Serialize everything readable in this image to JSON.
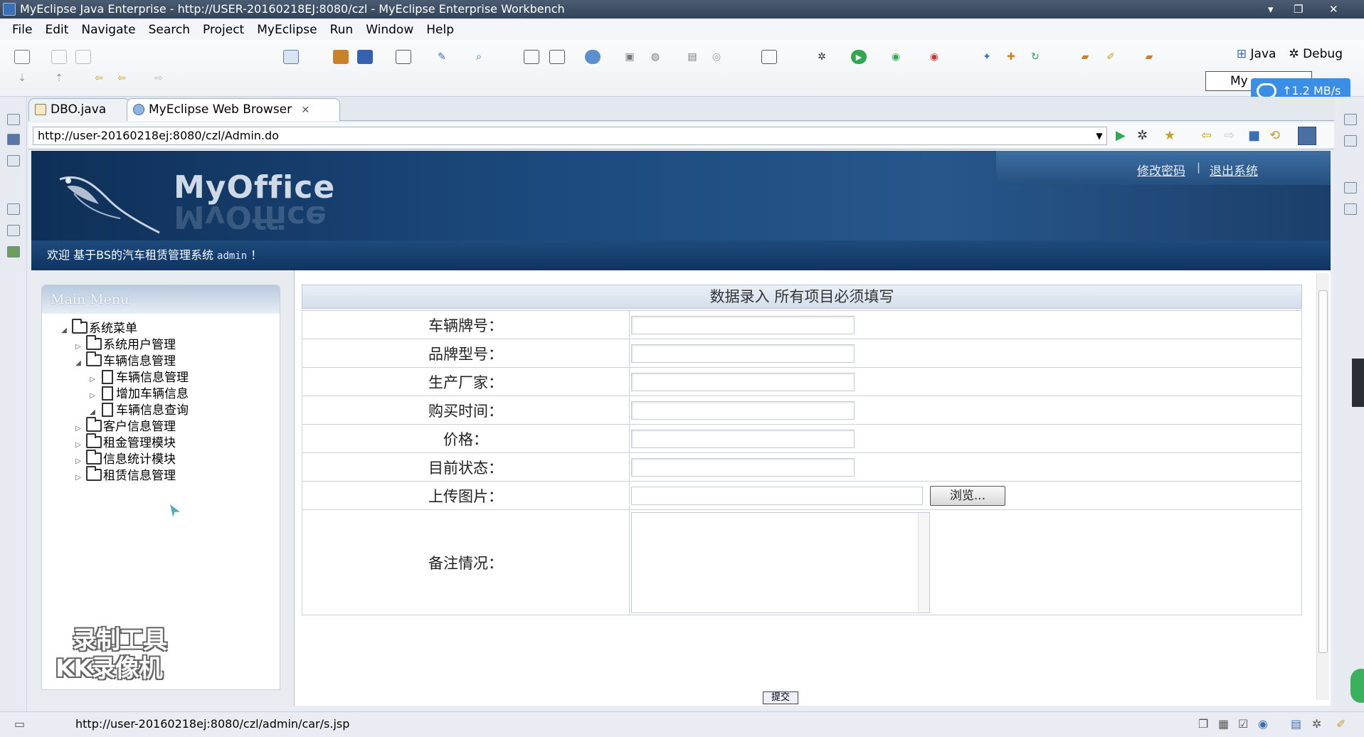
{
  "window": {
    "title": "MyEclipse Java Enterprise - http://USER-20160218EJ:8080/czl - MyEclipse Enterprise Workbench"
  },
  "menu": [
    "File",
    "Edit",
    "Navigate",
    "Search",
    "Project",
    "MyEclipse",
    "Run",
    "Window",
    "Help"
  ],
  "perspectives": {
    "java": "Java",
    "debug": "Debug",
    "myeclipse_partial": "My"
  },
  "network": {
    "speed": "1.2 MB/s"
  },
  "editor_tabs": [
    {
      "label": "DBO.java"
    },
    {
      "label": "MyEclipse Web Browser"
    }
  ],
  "browser": {
    "url": "http://user-20160218ej:8080/czl/Admin.do"
  },
  "site": {
    "logo": "MyOffice",
    "top_links": [
      "修改密码",
      "退出系统"
    ],
    "welcome_prefix": "欢迎 基于BS的汽车租赁管理系统",
    "welcome_user": "admin",
    "welcome_suffix": "！"
  },
  "sidebar": {
    "title": "Main Menu",
    "tree": [
      {
        "label": "系统菜单",
        "level": 0,
        "expanded": true,
        "type": "folder"
      },
      {
        "label": "系统用户管理",
        "level": 1,
        "expanded": false,
        "type": "folder"
      },
      {
        "label": "车辆信息管理",
        "level": 1,
        "expanded": true,
        "type": "folder"
      },
      {
        "label": "车辆信息管理",
        "level": 2,
        "expanded": false,
        "type": "doc"
      },
      {
        "label": "增加车辆信息",
        "level": 2,
        "expanded": false,
        "type": "doc"
      },
      {
        "label": "车辆信息查询",
        "level": 2,
        "expanded": true,
        "type": "doc"
      },
      {
        "label": "客户信息管理",
        "level": 1,
        "expanded": false,
        "type": "folder"
      },
      {
        "label": "租金管理模块",
        "level": 1,
        "expanded": false,
        "type": "folder"
      },
      {
        "label": "信息统计模块",
        "level": 1,
        "expanded": false,
        "type": "folder"
      },
      {
        "label": "租赁信息管理",
        "level": 1,
        "expanded": false,
        "type": "folder"
      }
    ],
    "watermark": [
      "录制工具",
      "KK录像机"
    ]
  },
  "form": {
    "heading": "数据录入  所有项目必须填写",
    "fields": [
      {
        "label": "车辆牌号：",
        "value": ""
      },
      {
        "label": "品牌型号：",
        "value": ""
      },
      {
        "label": "生产厂家：",
        "value": ""
      },
      {
        "label": "购买时间：",
        "value": ""
      },
      {
        "label": "价格：",
        "value": ""
      },
      {
        "label": "目前状态：",
        "value": ""
      }
    ],
    "upload_label": "上传图片：",
    "browse_button": "浏览...",
    "remark_label": "备注情况：",
    "submit_button": "提交"
  },
  "status": {
    "url": "http://user-20160218ej:8080/czl/admin/car/s.jsp"
  }
}
